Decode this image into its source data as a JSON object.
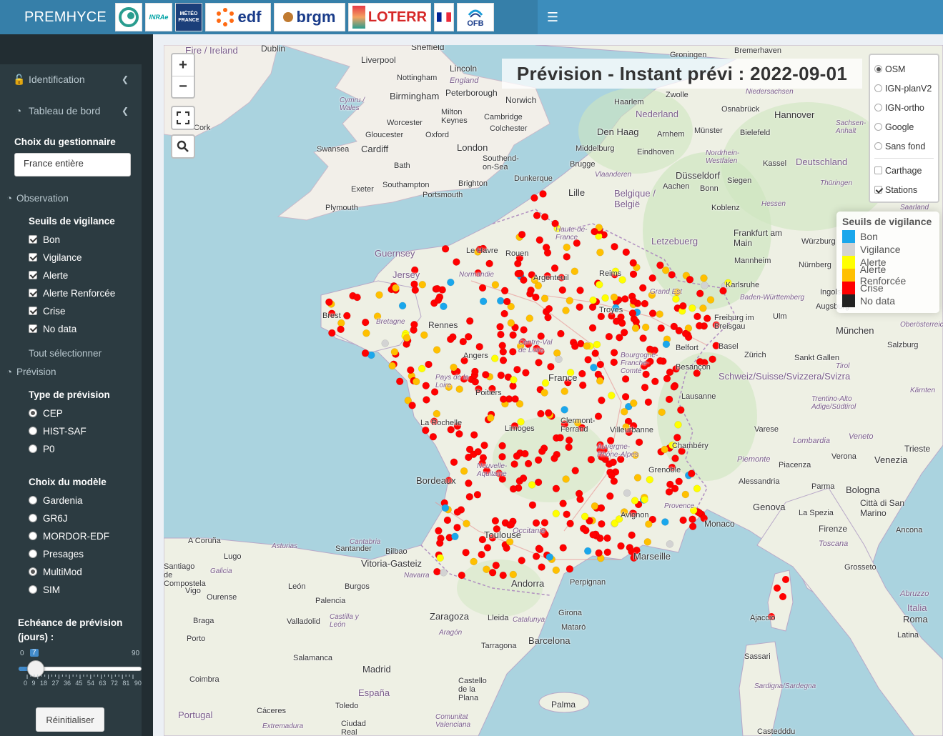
{
  "header": {
    "app_title": "PREMHYCE",
    "logos": [
      "inrae-cemagref",
      "INRAE",
      "METEO FRANCE",
      "edf",
      "brgm",
      "LOTERR",
      "republique-francaise",
      "OFB"
    ],
    "logo_texts": {
      "meteo": "MÉTÉO FRANCE",
      "edf": "edf",
      "brgm": "brgm",
      "loterr": "LOTERR",
      "ofb": "OFB",
      "inrae": "INRAe"
    }
  },
  "sidebar": {
    "menu": [
      {
        "label": "Identification",
        "icon": "unlock-icon"
      },
      {
        "label": "Tableau de bord",
        "icon": "dashboard-icon"
      }
    ],
    "gestionnaire_label": "Choix du gestionnaire",
    "gestionnaire_value": "France entière",
    "observation": {
      "label": "Observation",
      "seuils_label": "Seuils de vigilance",
      "seuils": [
        {
          "label": "Bon",
          "checked": true
        },
        {
          "label": "Vigilance",
          "checked": true
        },
        {
          "label": "Alerte",
          "checked": true
        },
        {
          "label": "Alerte Renforcée",
          "checked": true
        },
        {
          "label": "Crise",
          "checked": true
        },
        {
          "label": "No data",
          "checked": true
        }
      ],
      "select_all": "Tout sélectionner"
    },
    "prevision": {
      "label": "Prévision",
      "type_label": "Type de prévision",
      "types": [
        {
          "label": "CEP",
          "selected": true
        },
        {
          "label": "HIST-SAF",
          "selected": false
        },
        {
          "label": "P0",
          "selected": false
        }
      ],
      "model_label": "Choix du modèle",
      "models": [
        {
          "label": "Gardenia",
          "selected": false
        },
        {
          "label": "GR6J",
          "selected": false
        },
        {
          "label": "MORDOR-EDF",
          "selected": false
        },
        {
          "label": "Presages",
          "selected": false
        },
        {
          "label": "MultiMod",
          "selected": true
        },
        {
          "label": "SIM",
          "selected": false
        }
      ],
      "echeance_label_1": "Echéance de prévision",
      "echeance_label_2": "(jours) :",
      "slider_min": "0",
      "slider_max": "90",
      "slider_value": "7",
      "slider_value_num": 7,
      "slider_ticks": [
        "0",
        "9",
        "18",
        "27",
        "36",
        "45",
        "54",
        "63",
        "72",
        "81",
        "90"
      ],
      "reset_label": "Réinitialiser"
    }
  },
  "map": {
    "title": "Prévision - Instant prévi : 2022-09-01",
    "zoom_in": "+",
    "zoom_out": "−",
    "base_layers": [
      {
        "label": "OSM",
        "selected": true
      },
      {
        "label": "IGN-planV2",
        "selected": false
      },
      {
        "label": "IGN-ortho",
        "selected": false
      },
      {
        "label": "Google",
        "selected": false
      },
      {
        "label": "Sans fond",
        "selected": false
      }
    ],
    "overlays": [
      {
        "label": "Carthage",
        "checked": false
      },
      {
        "label": "Stations",
        "checked": true
      }
    ],
    "legend": {
      "title": "Seuils de vigilance",
      "items": [
        {
          "label": "Bon",
          "color": "#1aa7ec"
        },
        {
          "label": "Vigilance",
          "color": "#d3d3d3"
        },
        {
          "label": "Alerte",
          "color": "#ffff00"
        },
        {
          "label": "Alerte Renforcée",
          "color": "#ffc000"
        },
        {
          "label": "Crise",
          "color": "#ff0000"
        },
        {
          "label": "No data",
          "color": "#222222"
        }
      ]
    },
    "place_labels": [
      "Eire / Ireland",
      "Dublin",
      "Liverpool",
      "Sheffield",
      "Nottingham",
      "Lincoln",
      "England",
      "Birmingham",
      "Peterborough",
      "Norwich",
      "Cymru / Wales",
      "Milton Keynes",
      "Cambridge",
      "Worcester",
      "Colchester",
      "Gloucester",
      "Oxford",
      "Swansea",
      "Cardiff",
      "London",
      "Southend-on-Sea",
      "Bath",
      "Exeter",
      "Southampton",
      "Brighton",
      "Portsmouth",
      "Plymouth",
      "Cork",
      "Guernsey",
      "Jersey",
      "Groningen",
      "Bremerhaven",
      "Zwolle",
      "Haarlem",
      "Nederland",
      "Osnabrück",
      "Hannover",
      "Den Haag",
      "Arnhem",
      "Münster",
      "Bielefeld",
      "Middelburg",
      "Eindhoven",
      "Kassel",
      "Deutschland",
      "Brugge",
      "Düsseldorf",
      "Dunkerque",
      "Lille",
      "Aachen",
      "Bonn",
      "Siegen",
      "Belgique / België",
      "Koblenz",
      "Frankfurt am Main",
      "Letzebuerg",
      "Würzburg",
      "Mannheim",
      "Nürnberg",
      "Karlsruhe",
      "Ingolstadt",
      "Augsburg",
      "Ulm",
      "München",
      "Freiburg im Breisgau",
      "Basel",
      "Zürich",
      "Sankt Gallen",
      "Salzburg",
      "Schweiz/Suisse/Svizzera/Svizra",
      "Lausanne",
      "Trentino-Alto Adige/Südtirol",
      "Varese",
      "Lombardia",
      "Veneto",
      "Venezia",
      "Trieste",
      "Verona",
      "Piemonte",
      "Piacenza",
      "Alessandria",
      "Parma",
      "Bologna",
      "Genova",
      "La Spezia",
      "Città di San Marino",
      "Firenze",
      "Ancona",
      "Toscana",
      "Grosseto",
      "Abruzzo",
      "Italia",
      "Roma",
      "Latina",
      "Sassari",
      "Sardigna/Sardegna",
      "Ajaccio",
      "Monaco",
      "Marseille",
      "Avignon",
      "Toulouse",
      "Occitanie",
      "Bordeaux",
      "Nouvelle-Aquitaine",
      "La Rochelle",
      "Poitiers",
      "Angers",
      "Rennes",
      "Bretagne",
      "Brest",
      "Le Havre",
      "Rouen",
      "Normandie",
      "Argenteuil",
      "Reims",
      "Troyes",
      "Bourgogne-Franche-Comté",
      "Besançon",
      "Belfort",
      "Chambéry",
      "Grenoble",
      "Provence",
      "Clermont-Ferrand",
      "Villeurbanne",
      "Limoges",
      "Andorra",
      "Perpignan",
      "A Coruña",
      "Lugo",
      "Asturias",
      "Santander",
      "Bilbao",
      "Vitoria-Gasteiz",
      "Navarra",
      "León",
      "Burgos",
      "Palencia",
      "Zaragoza",
      "Lleida",
      "Catalunya",
      "Girona",
      "Mataró",
      "Barcelona",
      "Tarragona",
      "Aragón",
      "Valladolid",
      "Castilla y León",
      "Braga",
      "Porto",
      "Salamanca",
      "Coimbra",
      "Madrid",
      "España",
      "Castello de la Plana",
      "Palma",
      "Cáceres",
      "Toledo",
      "Extremadura",
      "Ciudad Real",
      "Comunitat Valenciana",
      "Portugal",
      "Vigo",
      "Ourense",
      "Santiago de Compostela",
      "Galicia",
      "Cantabria",
      "Haute-de-France",
      "Centre-Val de Loire",
      "France",
      "Auvergne-Rhône-Alpes",
      "Pays de la Loire",
      "Grand Est",
      "Niedersachsen",
      "Nordrhein-Westfalen",
      "Hessen",
      "Thüringen",
      "Sachsen-Anhalt",
      "Baden-Württemberg",
      "Oberösterreich",
      "Tirol",
      "Kärnten",
      "Saarland",
      "Vlaanderen",
      "Castedddu"
    ]
  }
}
